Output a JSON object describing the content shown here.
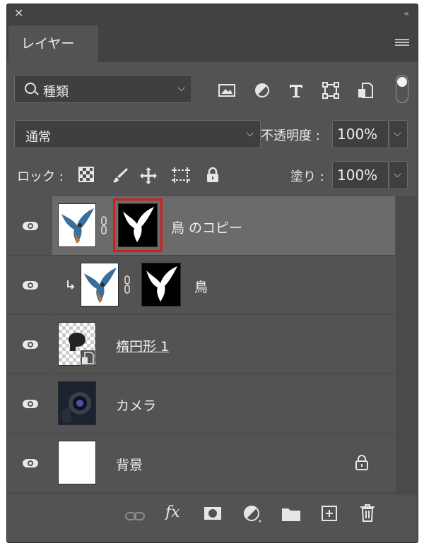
{
  "panel": {
    "close_glyph": "✕",
    "collapse_glyph": "‹‹",
    "tab_title": "レイヤー"
  },
  "filter": {
    "kind_label": "種類",
    "icons": [
      "image-filter-icon",
      "adjustment-filter-icon",
      "type-filter-icon",
      "shape-filter-icon",
      "smart-object-filter-icon"
    ]
  },
  "blend": {
    "mode": "通常",
    "opacity_label": "不透明度 :",
    "opacity_value": "100%"
  },
  "lock": {
    "label": "ロック :",
    "fill_label": "塗り :",
    "fill_value": "100%"
  },
  "layers": [
    {
      "name": "鳥 のコピー",
      "selected": true,
      "has_mask": true
    },
    {
      "name": "鳥",
      "clipped": true,
      "has_mask": true
    },
    {
      "name": "楕円形 1",
      "smart_object": true
    },
    {
      "name": "カメラ"
    },
    {
      "name": "背景",
      "locked": true
    }
  ],
  "footer": {
    "fx_label": "fx"
  },
  "colors": {
    "panel_bg": "#535353",
    "selected_row": "#6b6b6b",
    "selection_outline": "#d31d1d"
  }
}
